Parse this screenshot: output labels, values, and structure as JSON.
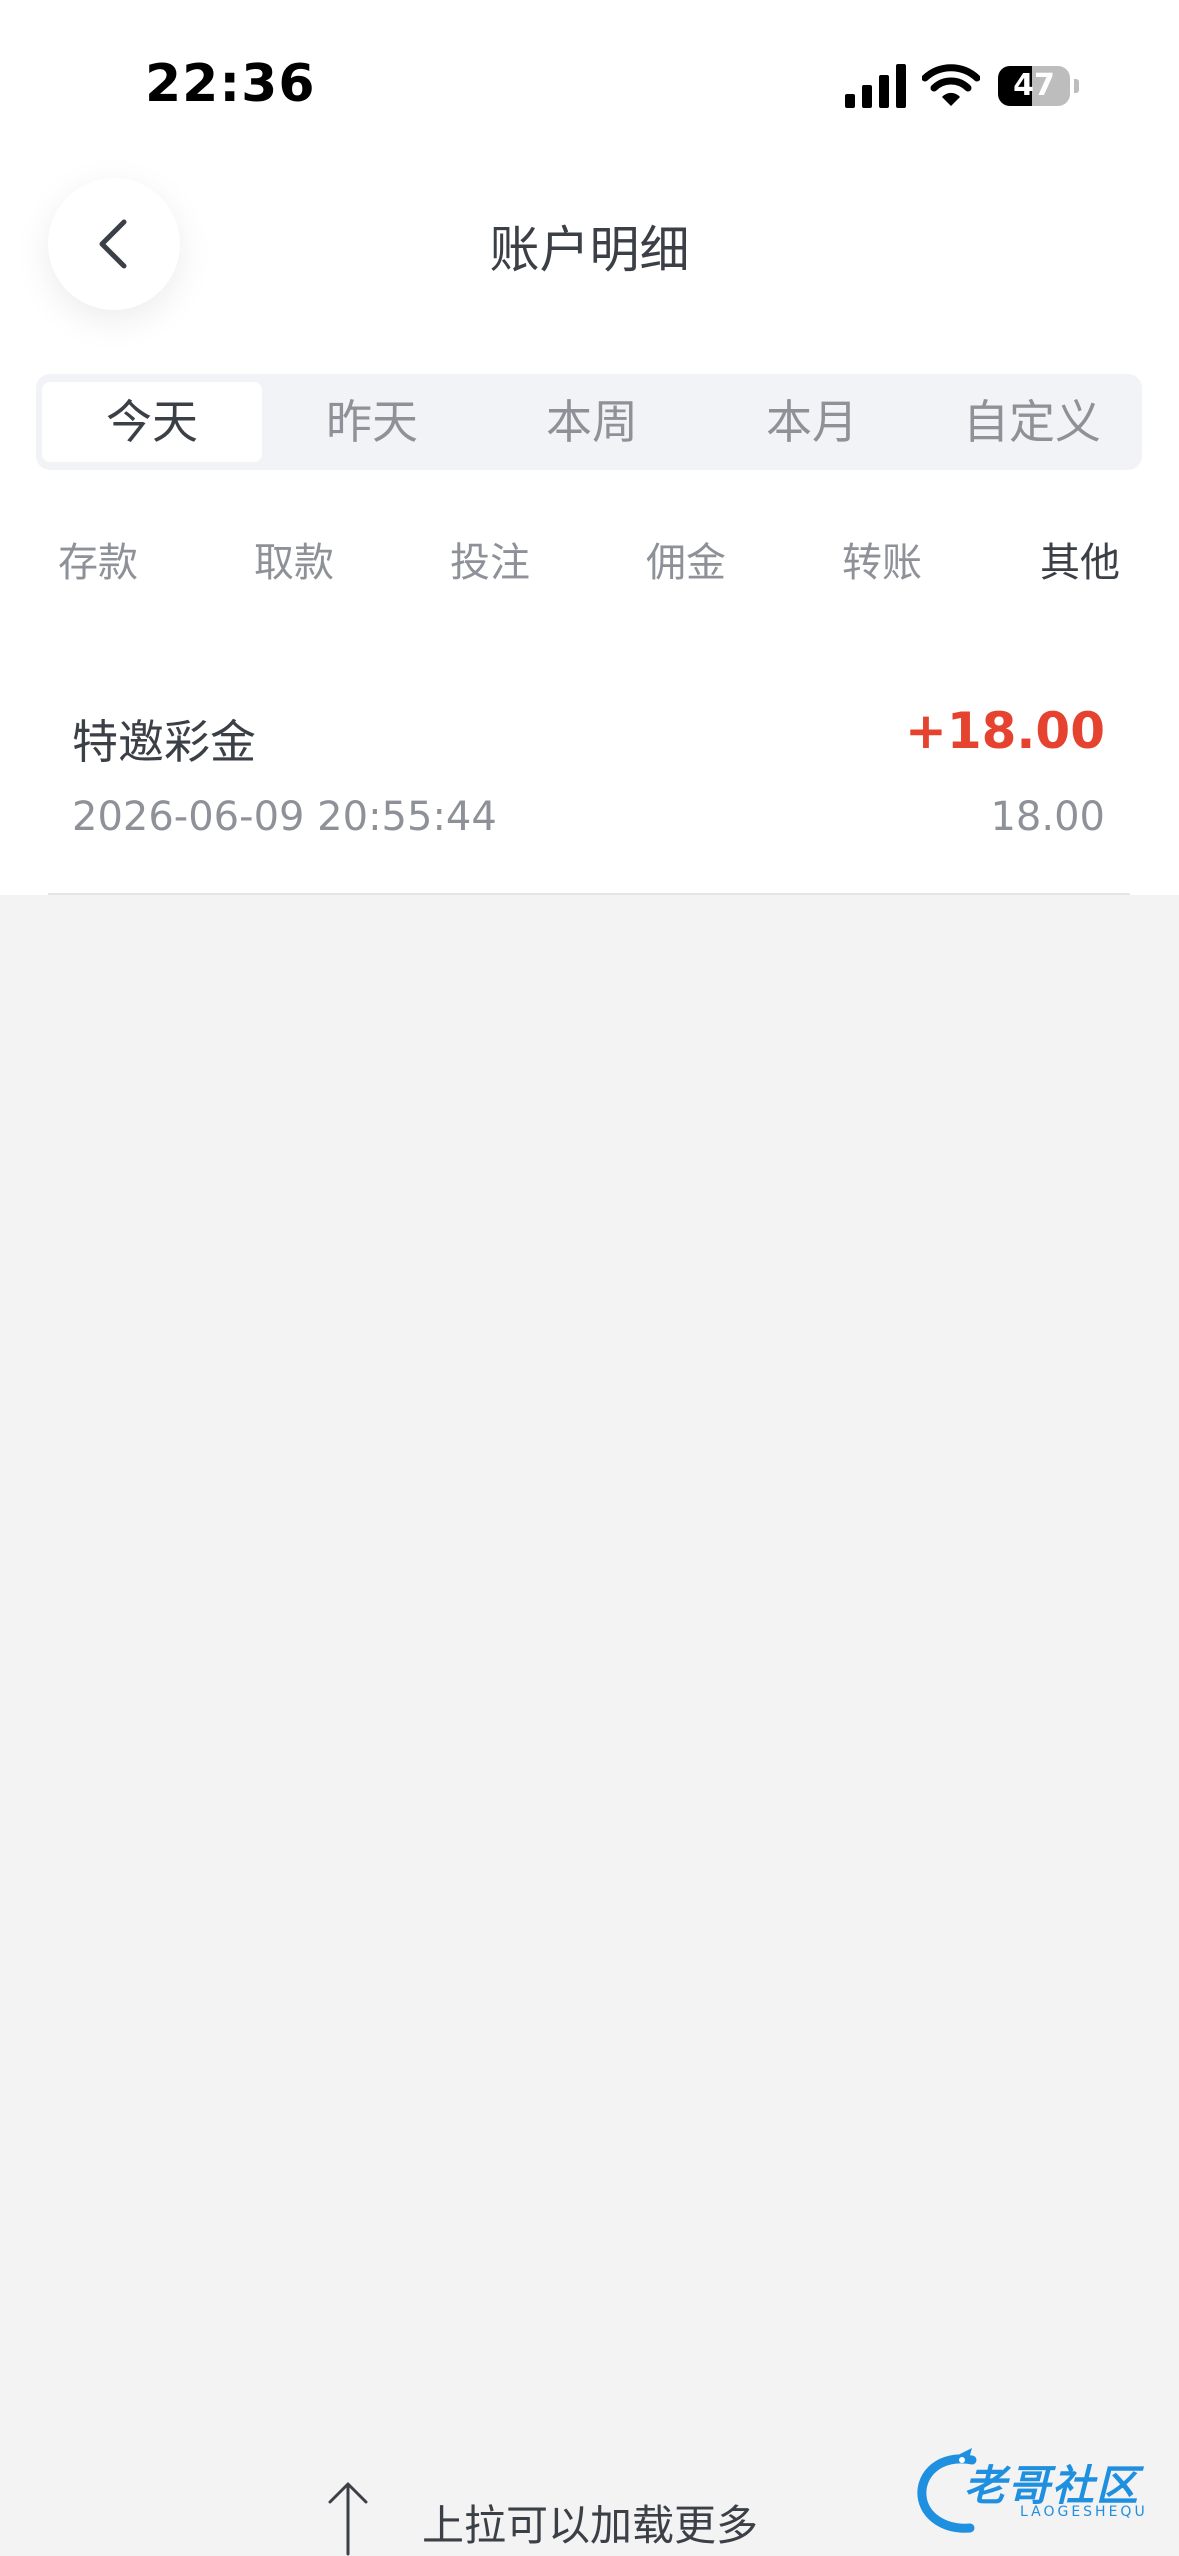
{
  "status_bar": {
    "time": "22:36",
    "battery": "47",
    "battery_level_percent": 47
  },
  "header": {
    "title": "账户明细"
  },
  "date_tabs": [
    {
      "label": "今天",
      "active": true
    },
    {
      "label": "昨天",
      "active": false
    },
    {
      "label": "本周",
      "active": false
    },
    {
      "label": "本月",
      "active": false
    },
    {
      "label": "自定义",
      "active": false
    }
  ],
  "type_filters": [
    {
      "label": "存款",
      "active": false
    },
    {
      "label": "取款",
      "active": false
    },
    {
      "label": "投注",
      "active": false
    },
    {
      "label": "佣金",
      "active": false
    },
    {
      "label": "转账",
      "active": false
    },
    {
      "label": "其他",
      "active": true
    }
  ],
  "records": [
    {
      "title": "特邀彩金",
      "amount": "+18.00",
      "time": "2026-06-09 20:55:44",
      "balance": "18.00"
    }
  ],
  "footer": {
    "load_more": "上拉可以加载更多"
  },
  "watermark": {
    "text": "老哥社区",
    "sub": "LAOGESHEQU"
  },
  "colors": {
    "accent_red": "#e5432f",
    "text_primary": "#3b3f46",
    "text_secondary": "#8e9298",
    "background": "#f3f3f4"
  }
}
